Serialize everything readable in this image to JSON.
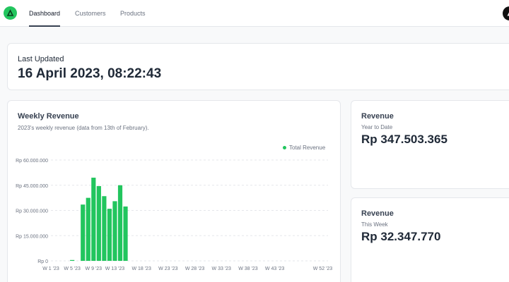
{
  "nav": {
    "tabs": [
      {
        "label": "Dashboard",
        "active": true
      },
      {
        "label": "Customers",
        "active": false
      },
      {
        "label": "Products",
        "active": false
      }
    ],
    "logo_icon": "triangle-logo-icon",
    "avatar_icon": "user-avatar-icon"
  },
  "last_updated": {
    "label": "Last Updated",
    "value": "16 April 2023, 08:22:43"
  },
  "weekly_revenue": {
    "title": "Weekly Revenue",
    "subtitle": "2023's weekly revenue (data from 13th of February)."
  },
  "revenue_ytd": {
    "title": "Revenue",
    "subtitle": "Year to Date",
    "value": "Rp 347.503.365"
  },
  "revenue_week": {
    "title": "Revenue",
    "subtitle": "This Week",
    "value": "Rp 32.347.770"
  },
  "colors": {
    "accent": "#22c55e",
    "grid": "#e5e7eb",
    "text_muted": "#6b7280"
  },
  "chart_data": {
    "type": "bar",
    "title": "Weekly Revenue",
    "legend": [
      "Total Revenue"
    ],
    "legend_position": "top-right",
    "grid": true,
    "ylim": [
      0,
      60000000
    ],
    "y_ticks": [
      "Rp 0",
      "Rp 15.000.000",
      "Rp 30.000.000",
      "Rp 45.000.000",
      "Rp 60.000.000"
    ],
    "x_tick_labels": [
      "W 1 '23",
      "W 5 '23",
      "W 9 '23",
      "W 13 '23",
      "W 18 '23",
      "W 23 '23",
      "W 28 '23",
      "W 33 '23",
      "W 38 '23",
      "W 43 '23",
      "W 52 '23"
    ],
    "series": [
      {
        "name": "Total Revenue",
        "weeks": [
          5,
          6,
          7,
          8,
          9,
          10,
          11,
          12,
          13,
          14,
          15
        ],
        "values": [
          500000,
          0,
          33500000,
          37500000,
          49500000,
          44500000,
          38500000,
          31000000,
          35500000,
          45000000,
          32350000
        ]
      }
    ]
  }
}
